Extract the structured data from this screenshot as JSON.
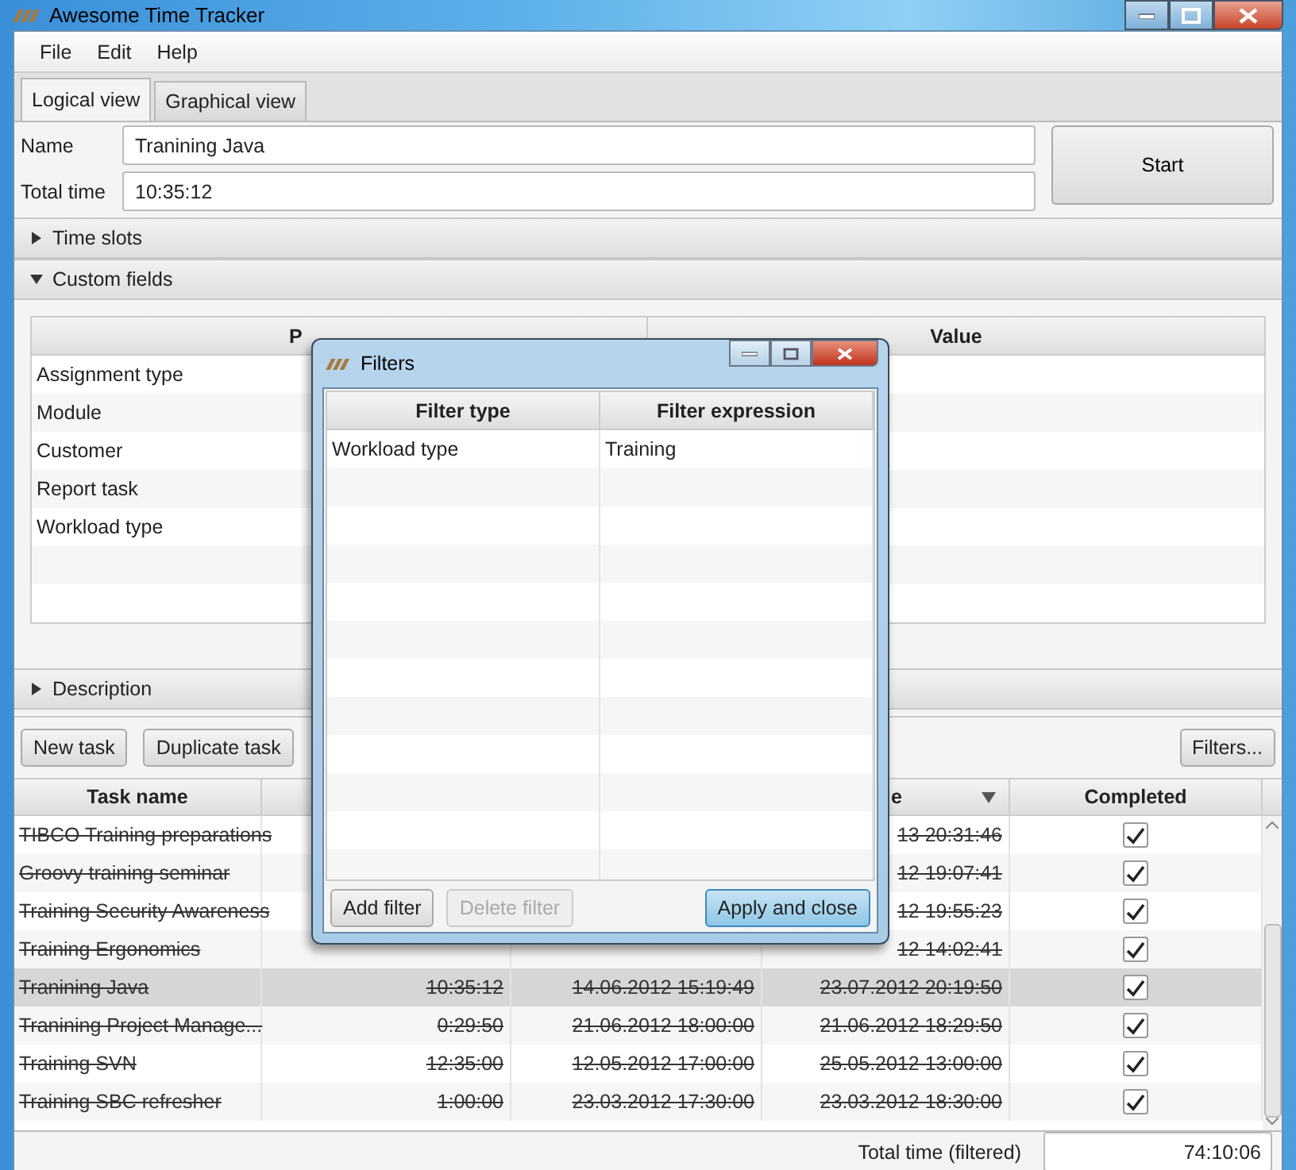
{
  "window": {
    "title": "Awesome Time Tracker"
  },
  "menu": [
    "File",
    "Edit",
    "Help"
  ],
  "tabs": [
    {
      "label": "Logical view",
      "selected": true
    },
    {
      "label": "Graphical view",
      "selected": false
    }
  ],
  "form": {
    "name_label": "Name",
    "name_value": "Tranining Java",
    "total_label": "Total time",
    "total_value": "10:35:12",
    "start_button": "Start"
  },
  "sections": [
    {
      "title": "Time slots",
      "expanded": false
    },
    {
      "title": "Custom fields",
      "expanded": true
    },
    {
      "title": "Description",
      "expanded": false
    }
  ],
  "custom_fields": {
    "column_1": "P",
    "column_2": "Value",
    "rows": [
      "Assignment type",
      "Module",
      "Customer",
      "Report task",
      "Workload type"
    ]
  },
  "toolbar": {
    "buttons": [
      "New task",
      "Duplicate task"
    ],
    "filters_button": "Filters..."
  },
  "tasks": {
    "columns": {
      "task_name": "Task name",
      "column_4": {
        "label": "e",
        "sorted": true
      },
      "completed": "Completed"
    },
    "rows": [
      {
        "name": "TIBCO Training preparations",
        "end": "13 20:31:46",
        "completed": true,
        "selected": false
      },
      {
        "name": "Groovy training seminar",
        "end": "12 19:07:41",
        "completed": true,
        "selected": false
      },
      {
        "name": "Training Security Awareness",
        "end": "12 19:55:23",
        "completed": true,
        "selected": false
      },
      {
        "name": "Training Ergonomics",
        "end": "12 14:02:41",
        "completed": true,
        "selected": false
      },
      {
        "name": "Tranining Java",
        "time": "10:35:12",
        "start": "14.06.2012 15:19:49",
        "end": "23.07.2012 20:19:50",
        "completed": true,
        "selected": true
      },
      {
        "name": "Tranining Project Manage...",
        "time": "0:29:50",
        "start": "21.06.2012 18:00:00",
        "end": "21.06.2012 18:29:50",
        "completed": true,
        "selected": false
      },
      {
        "name": "Training SVN",
        "time": "12:35:00",
        "start": "12.05.2012 17:00:00",
        "end": "25.05.2012 13:00:00",
        "completed": true,
        "selected": false
      },
      {
        "name": "Training SBC refresher",
        "time": "1:00:00",
        "start": "23.03.2012 17:30:00",
        "end": "23.03.2012 18:30:00",
        "completed": true,
        "selected": false
      }
    ]
  },
  "footer": {
    "label": "Total time (filtered)",
    "value": "74:10:06"
  },
  "dialog": {
    "title": "Filters",
    "columns": [
      "Filter type",
      "Filter expression"
    ],
    "rows": [
      {
        "type": "Workload type",
        "expression": "Training"
      }
    ],
    "buttons": [
      {
        "label": "Add filter",
        "disabled": false,
        "default": false
      },
      {
        "label": "Delete filter",
        "disabled": true,
        "default": false
      },
      {
        "label": "Apply and close",
        "disabled": false,
        "default": true
      }
    ]
  }
}
